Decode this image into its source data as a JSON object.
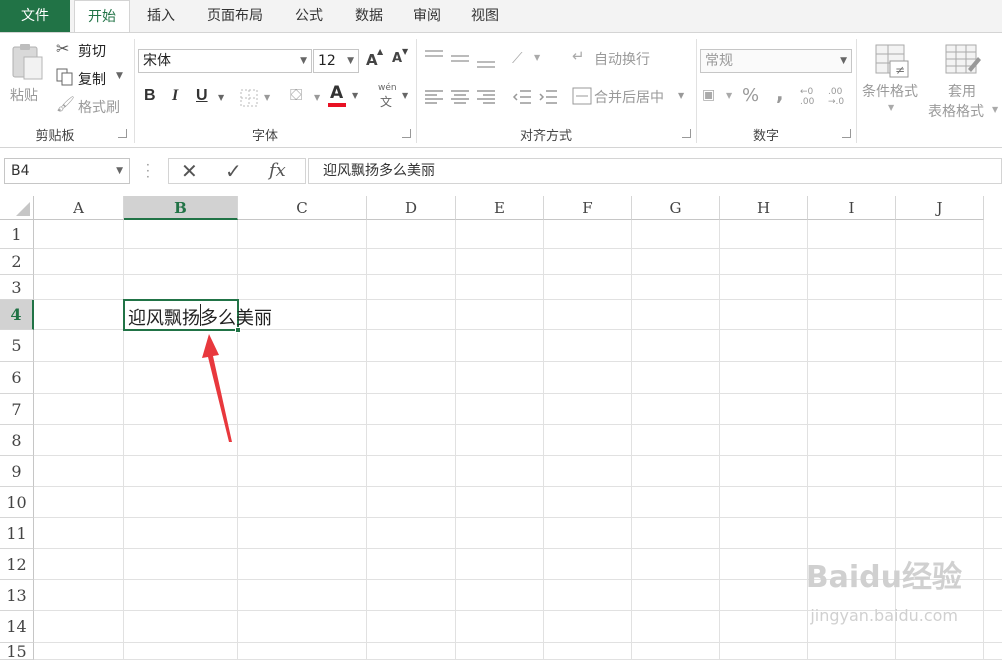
{
  "tabs": [
    {
      "label": "文件",
      "kind": "file"
    },
    {
      "label": "开始",
      "kind": "active"
    },
    {
      "label": "插入",
      "kind": "normal"
    },
    {
      "label": "页面布局",
      "kind": "normal"
    },
    {
      "label": "公式",
      "kind": "normal"
    },
    {
      "label": "数据",
      "kind": "normal"
    },
    {
      "label": "审阅",
      "kind": "normal"
    },
    {
      "label": "视图",
      "kind": "normal"
    }
  ],
  "clipboard": {
    "paste": "粘贴",
    "cut": "剪切",
    "copy": "复制",
    "format_painter": "格式刷",
    "group": "剪贴板"
  },
  "font": {
    "name": "宋体",
    "size": "12",
    "bold": "B",
    "italic": "I",
    "underline": "U",
    "grow": "A",
    "shrink": "A",
    "color_letter": "A",
    "phonetic_top": "wén",
    "phonetic_bottom": "文",
    "group": "字体"
  },
  "alignment": {
    "wrap_text": "自动换行",
    "merge_center": "合并后居中",
    "group": "对齐方式"
  },
  "number": {
    "format": "常规",
    "percent": "%",
    "comma": ",",
    "group": "数字"
  },
  "styles": {
    "conditional": "条件格式",
    "table_line1": "套用",
    "table_line2": "表格格式"
  },
  "formula_bar": {
    "name_box": "B4",
    "fx": "fx",
    "content": "迎风飘扬多么美丽"
  },
  "columns": [
    "A",
    "B",
    "C",
    "D",
    "E",
    "F",
    "G",
    "H",
    "I",
    "J"
  ],
  "rows": [
    "1",
    "2",
    "3",
    "4",
    "5",
    "6",
    "7",
    "8",
    "9",
    "10",
    "11",
    "12",
    "13",
    "14",
    "15"
  ],
  "selected_cell": "B4",
  "cell_B4": {
    "text_before_caret": "迎风飘扬",
    "text_after_caret": "多么美丽"
  },
  "colors": {
    "accent": "#217346",
    "annotation_arrow": "#e8383d",
    "font_color_bar": "#e81123"
  },
  "watermark": {
    "title": "Baidu经验",
    "url": "jingyan.baidu.com"
  }
}
